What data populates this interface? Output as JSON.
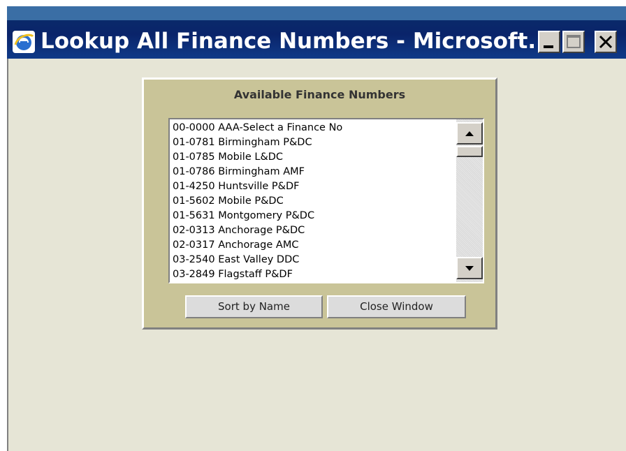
{
  "window": {
    "title": "Lookup All Finance Numbers - Microsoft...",
    "icon": "ie-icon",
    "controls": [
      "minimize-icon",
      "maximize-icon",
      "close-icon"
    ]
  },
  "panel": {
    "title": "Available Finance Numbers",
    "list_items": [
      "00-0000 AAA-Select a Finance No",
      "01-0781 Birmingham P&DC",
      "01-0785 Mobile L&DC",
      "01-0786 Birmingham AMF",
      "01-4250 Huntsville P&DF",
      "01-5602 Mobile P&DC",
      "01-5631 Montgomery P&DC",
      "02-0313 Anchorage P&DC",
      "02-0317 Anchorage AMC",
      "03-2540 East Valley DDC",
      "03-2849 Flagstaff P&DF"
    ],
    "buttons": {
      "sort": "Sort by Name",
      "close": "Close Window"
    }
  },
  "colors": {
    "titlebar": "#0a246a",
    "client_bg": "#e6e5d6",
    "panel_bg": "#c9c498"
  }
}
